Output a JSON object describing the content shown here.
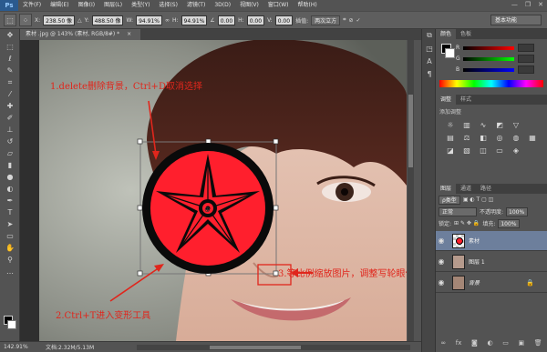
{
  "menubar": {
    "logo": "Ps",
    "items": [
      "文件(F)",
      "编辑(E)",
      "图像(I)",
      "图层(L)",
      "类型(Y)",
      "选择(S)",
      "滤镜(T)",
      "3D(D)",
      "视图(V)",
      "窗口(W)",
      "帮助(H)"
    ],
    "minimize": "—",
    "maximize": "❐",
    "close": "✕"
  },
  "options": {
    "x_label": "X:",
    "x_value": "238.50 像",
    "y_label": "Y:",
    "y_value": "488.50 像",
    "w_label": "W:",
    "w_value": "94.91%",
    "h_label": "H:",
    "h_value": "94.91%",
    "angle_value": "0.00",
    "hskew_label": "H:",
    "hskew_value": "0.00",
    "vskew_label": "V:",
    "vskew_value": "0.00",
    "interp_label": "插值:",
    "interp_value": "两次立方",
    "workspace": "基本功能"
  },
  "document": {
    "tab_label": "素材 .jpg @ 143% (素材, RGB/8#) *",
    "tab_close": "×"
  },
  "status": {
    "zoom": "142.91%",
    "doc_info": "文档:2.32M/5.13M"
  },
  "color_panel": {
    "tab_color": "颜色",
    "tab_swatches": "色板",
    "r_label": "R",
    "g_label": "G",
    "b_label": "B"
  },
  "adjustments_panel": {
    "tab_adjust": "调整",
    "tab_styles": "样式",
    "add_label": "添加调整"
  },
  "layers_panel": {
    "tab_layers": "图层",
    "tab_channels": "通道",
    "tab_paths": "路径",
    "kind_label": "ρ类型",
    "blend_mode": "正常",
    "opacity_label": "不透明度:",
    "opacity_value": "100%",
    "lock_label": "锁定:",
    "fill_label": "填充:",
    "fill_value": "100%",
    "layers": [
      {
        "name": "素材"
      },
      {
        "name": "图层 1"
      },
      {
        "name": "背景"
      }
    ]
  },
  "annotations": {
    "step1": "1.delete删除背景，Ctrl+D取消选择",
    "step2": "2.Ctrl+T进入变形工具",
    "step3": "3.等比例缩放图片，调整写轮眼位置"
  },
  "colors": {
    "annotation": "#e0261c",
    "sharingan_red": "#ff1f2d",
    "selected_layer": "#6d7f9c"
  }
}
